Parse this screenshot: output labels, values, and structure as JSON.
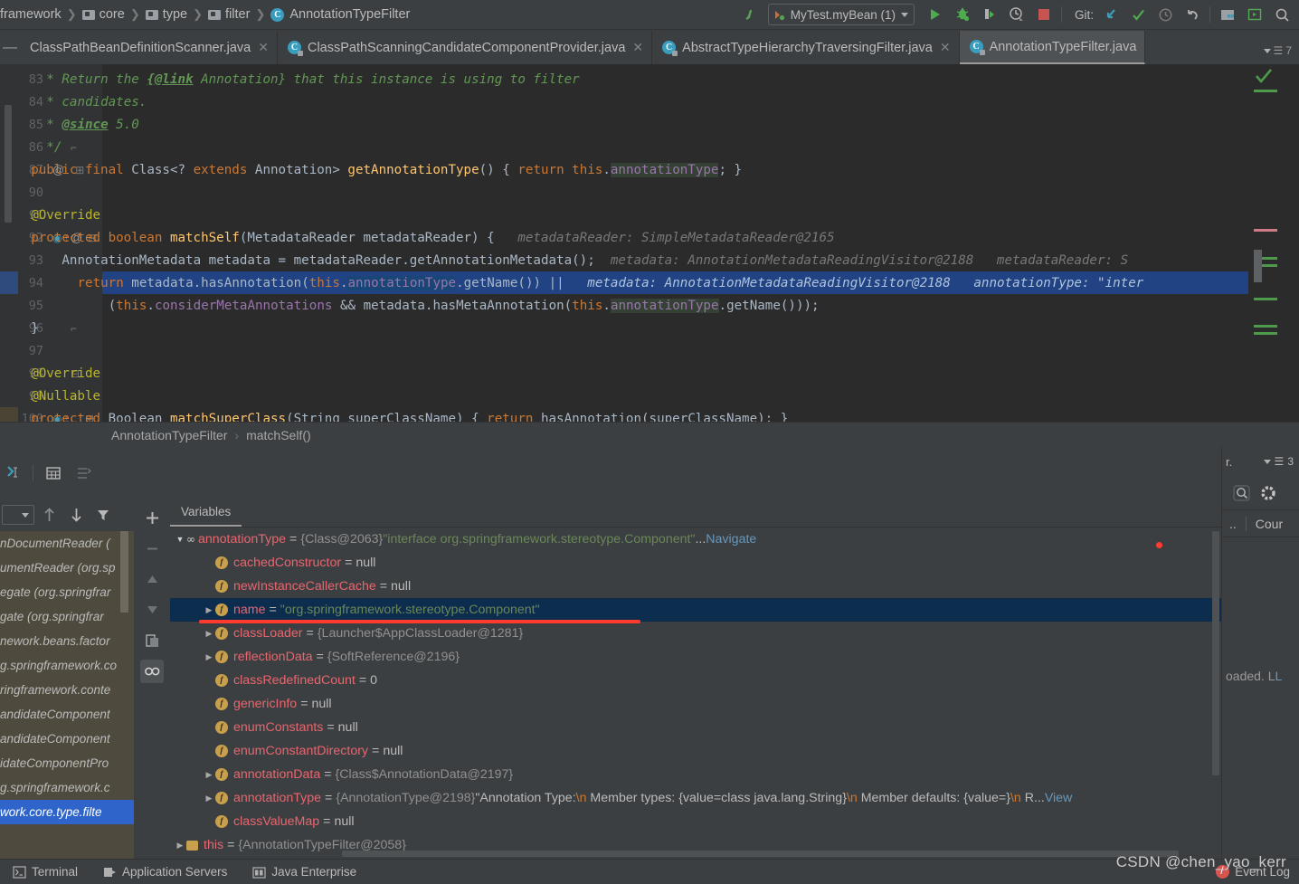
{
  "navbar": {
    "breadcrumb": [
      {
        "label": "framework",
        "icon": "none"
      },
      {
        "label": "core",
        "icon": "folder-icon"
      },
      {
        "label": "type",
        "icon": "folder-icon"
      },
      {
        "label": "filter",
        "icon": "folder-icon"
      },
      {
        "label": "AnnotationTypeFilter",
        "icon": "class-icon"
      }
    ],
    "run_config": "MyTest.myBean (1)",
    "git_label": "Git:",
    "icons": [
      "back-arrow-icon",
      "run-icon",
      "debug-icon",
      "run-with-coverage-icon",
      "profiler-icon",
      "stop-icon",
      "update-project-icon",
      "commit-icon",
      "history-icon",
      "rollback-icon",
      "project-structure-icon",
      "run-anything-icon",
      "search-everywhere-icon"
    ]
  },
  "tabs": [
    {
      "label": "ClassPathBeanDefinitionScanner.java",
      "active": false,
      "closable": true,
      "icon": false
    },
    {
      "label": "ClassPathScanningCandidateComponentProvider.java",
      "active": false,
      "closable": true,
      "icon": true
    },
    {
      "label": "AbstractTypeHierarchyTraversingFilter.java",
      "active": false,
      "closable": true,
      "icon": true
    },
    {
      "label": "AnnotationTypeFilter.java",
      "active": true,
      "closable": false,
      "icon": true
    }
  ],
  "tab_overflow_count": "7",
  "editor": {
    "lines": [
      {
        "num": "83",
        "gutter": "",
        "indent": 6,
        "segments": [
          {
            "t": "* Return the ",
            "c": "c-cmt"
          },
          {
            "t": "{@link",
            "c": "c-cmt-link"
          },
          {
            "t": " Annotation} that this instance is using to filter",
            "c": "c-cmt"
          }
        ]
      },
      {
        "num": "84",
        "gutter": "",
        "indent": 6,
        "segments": [
          {
            "t": "* candidates.",
            "c": "c-cmt"
          }
        ]
      },
      {
        "num": "85",
        "gutter": "",
        "indent": 6,
        "segments": [
          {
            "t": "* ",
            "c": "c-cmt"
          },
          {
            "t": "@since",
            "c": "c-cmt-link"
          },
          {
            "t": " 5.0",
            "c": "c-cmt"
          }
        ]
      },
      {
        "num": "86",
        "gutter": "fold-end",
        "indent": 6,
        "segments": [
          {
            "t": "*/",
            "c": "c-cmt"
          }
        ]
      },
      {
        "num": "87",
        "gutter": "at-plus",
        "indent": 4,
        "segments": [
          {
            "t": "public final ",
            "c": "c-kw"
          },
          {
            "t": "Class<? ",
            "c": "c-def"
          },
          {
            "t": "extends ",
            "c": "c-kw"
          },
          {
            "t": "Annotation> ",
            "c": "c-def"
          },
          {
            "t": "getAnnotationType",
            "c": "c-fn"
          },
          {
            "t": "() { ",
            "c": "c-def"
          },
          {
            "t": "return ",
            "c": "c-kw"
          },
          {
            "t": "this",
            "c": "c-kw"
          },
          {
            "t": ".",
            "c": "c-def"
          },
          {
            "t": "annotationType",
            "c": "c-fld c-fldbg"
          },
          {
            "t": "; }",
            "c": "c-def"
          }
        ]
      },
      {
        "num": "90",
        "gutter": "",
        "indent": 0,
        "segments": []
      },
      {
        "num": "91",
        "gutter": "",
        "indent": 4,
        "segments": [
          {
            "t": "@Override",
            "c": "c-ann"
          }
        ]
      },
      {
        "num": "92",
        "gutter": "bp-at-fold",
        "indent": 4,
        "segments": [
          {
            "t": "protected boolean ",
            "c": "c-kw"
          },
          {
            "t": "matchSelf",
            "c": "c-fn"
          },
          {
            "t": "(MetadataReader metadataReader) { ",
            "c": "c-def"
          },
          {
            "t": "  metadataReader: SimpleMetadataReader@2165",
            "c": "c-hint"
          }
        ]
      },
      {
        "num": "93",
        "gutter": "",
        "indent": 8,
        "segments": [
          {
            "t": "AnnotationMetadata metadata = metadataReader.getAnnotationMetadata();",
            "c": "c-def"
          },
          {
            "t": "  metadata: AnnotationMetadataReadingVisitor@2188",
            "c": "c-hint"
          },
          {
            "t": "   metadataReader: S",
            "c": "c-hint"
          }
        ]
      },
      {
        "num": "94",
        "gutter": "",
        "indent": 10,
        "highlight": true,
        "segments": [
          {
            "t": "return ",
            "c": "c-kw"
          },
          {
            "t": "metadata.hasAnnotation(",
            "c": "c-def"
          },
          {
            "t": "this",
            "c": "c-kw"
          },
          {
            "t": ".",
            "c": "c-def"
          },
          {
            "t": "annotationType",
            "c": "c-fld c-sel"
          },
          {
            "t": ".getName()) ",
            "c": "c-def"
          },
          {
            "t": "||",
            "c": "c-def"
          },
          {
            "t": "   metadata: AnnotationMetadataReadingVisitor@2188",
            "c": "c-hint-b"
          },
          {
            "t": "   annotationType: \"inter",
            "c": "c-hint-b"
          }
        ]
      },
      {
        "num": "95",
        "gutter": "",
        "indent": 14,
        "segments": [
          {
            "t": "(",
            "c": "c-def"
          },
          {
            "t": "this",
            "c": "c-kw"
          },
          {
            "t": ".",
            "c": "c-def"
          },
          {
            "t": "considerMetaAnnotations",
            "c": "c-fld"
          },
          {
            "t": " && metadata.hasMetaAnnotation(",
            "c": "c-def"
          },
          {
            "t": "this",
            "c": "c-kw"
          },
          {
            "t": ".",
            "c": "c-def"
          },
          {
            "t": "annotationType",
            "c": "c-fld c-fldbg"
          },
          {
            "t": ".getName()));",
            "c": "c-def"
          }
        ]
      },
      {
        "num": "96",
        "gutter": "fold-end",
        "indent": 4,
        "segments": [
          {
            "t": "}",
            "c": "c-def"
          }
        ]
      },
      {
        "num": "97",
        "gutter": "",
        "indent": 0,
        "segments": []
      },
      {
        "num": "98",
        "gutter": "fold-start",
        "indent": 4,
        "segments": [
          {
            "t": "@Override",
            "c": "c-ann"
          }
        ]
      },
      {
        "num": "99",
        "gutter": "fold-end",
        "indent": 4,
        "segments": [
          {
            "t": "@Nullable",
            "c": "c-ann"
          }
        ]
      },
      {
        "num": "100",
        "gutter": "bp-plus",
        "indent": 4,
        "segments": [
          {
            "t": "protected ",
            "c": "c-kw"
          },
          {
            "t": "Boolean ",
            "c": "c-def"
          },
          {
            "t": "matchSuperClass",
            "c": "c-fn"
          },
          {
            "t": "(String superClassName) { ",
            "c": "c-def"
          },
          {
            "t": "return ",
            "c": "c-kw"
          },
          {
            "t": "hasAnnotation(superClassName); }",
            "c": "c-def"
          }
        ]
      }
    ],
    "crumb": [
      "AnnotationTypeFilter",
      "matchSelf()"
    ]
  },
  "debug": {
    "frames_toolbar_icons": [
      "thread-selector",
      "step-up-icon",
      "step-down-icon",
      "filter-icon"
    ],
    "frames": [
      {
        "label": "work.core.type.filte",
        "selected": true
      },
      {
        "label": "g.springframework.c",
        "selected": false
      },
      {
        "label": "idateComponentPro",
        "selected": false
      },
      {
        "label": "andidateComponent",
        "selected": false
      },
      {
        "label": "andidateComponent",
        "selected": false
      },
      {
        "label": "ringframework.conte",
        "selected": false
      },
      {
        "label": "g.springframework.co",
        "selected": false
      },
      {
        "label": "nework.beans.factor",
        "selected": false
      },
      {
        "label": "gate (org.springfrar",
        "selected": false
      },
      {
        "label": "egate (org.springfrar",
        "selected": false
      },
      {
        "label": "umentReader (org.sp",
        "selected": false
      },
      {
        "label": "nDocumentReader (",
        "selected": false
      }
    ],
    "vars_tab": "Variables",
    "variables": [
      {
        "depth": 0,
        "arrow": "down",
        "icon": "oo",
        "name": "annotationType",
        "eq": "=",
        "ref": "{Class@2063}",
        "value": "\"interface org.springframework.stereotype.Component\"",
        "value_class": "vstr",
        "suffix": "...",
        "link": "Navigate",
        "selected": false
      },
      {
        "depth": 1,
        "arrow": "none",
        "icon": "f",
        "name": "cachedConstructor",
        "eq": "=",
        "ref": "",
        "value": "null",
        "value_class": "vnull",
        "selected": false
      },
      {
        "depth": 1,
        "arrow": "none",
        "icon": "f",
        "name": "newInstanceCallerCache",
        "eq": "=",
        "ref": "",
        "value": "null",
        "value_class": "vnull",
        "selected": false
      },
      {
        "depth": 1,
        "arrow": "right",
        "icon": "f",
        "name": "name",
        "eq": "=",
        "ref": "",
        "value": "\"org.springframework.stereotype.Component\"",
        "value_class": "vstr",
        "selected": true,
        "underlined": true
      },
      {
        "depth": 1,
        "arrow": "right",
        "icon": "f",
        "name": "classLoader",
        "eq": "=",
        "ref": "{Launcher$AppClassLoader@1281}",
        "value": "",
        "selected": false
      },
      {
        "depth": 1,
        "arrow": "right",
        "icon": "f",
        "name": "reflectionData",
        "eq": "=",
        "ref": "{SoftReference@2196}",
        "value": "",
        "selected": false
      },
      {
        "depth": 1,
        "arrow": "none",
        "icon": "f",
        "name": "classRedefinedCount",
        "eq": "=",
        "ref": "",
        "value": "0",
        "value_class": "vnum",
        "selected": false
      },
      {
        "depth": 1,
        "arrow": "none",
        "icon": "f",
        "name": "genericInfo",
        "eq": "=",
        "ref": "",
        "value": "null",
        "value_class": "vnull",
        "selected": false
      },
      {
        "depth": 1,
        "arrow": "none",
        "icon": "f",
        "name": "enumConstants",
        "eq": "=",
        "ref": "",
        "value": "null",
        "value_class": "vnull",
        "selected": false
      },
      {
        "depth": 1,
        "arrow": "none",
        "icon": "f",
        "name": "enumConstantDirectory",
        "eq": "=",
        "ref": "",
        "value": "null",
        "value_class": "vnull",
        "selected": false
      },
      {
        "depth": 1,
        "arrow": "right",
        "icon": "f",
        "name": "annotationData",
        "eq": "=",
        "ref": "{Class$AnnotationData@2197}",
        "value": "",
        "selected": false
      },
      {
        "depth": 1,
        "arrow": "right",
        "icon": "f",
        "name": "annotationType",
        "eq": "=",
        "ref": "{AnnotationType@2198}",
        "value": "\"Annotation Type:\\n  Member types: {value=class java.lang.String}\\n  Member defaults: {value=}\\n  R...",
        "value_class": "vnull",
        "link": "View",
        "selected": false
      },
      {
        "depth": 1,
        "arrow": "none",
        "icon": "f",
        "name": "classValueMap",
        "eq": "=",
        "ref": "",
        "value": "null",
        "value_class": "vnull",
        "selected": false
      },
      {
        "depth": 0,
        "arrow": "right",
        "icon": "this",
        "name": "this",
        "eq": "=",
        "ref": "{AnnotationTypeFilter@2058}",
        "value": "",
        "selected": false
      }
    ],
    "right_panel": {
      "tab_count": "3",
      "tab_label": "r.",
      "icons": [
        "search-icon",
        "gear-icon"
      ],
      "header": [
        "..",
        "Cour"
      ],
      "text": "oaded. L"
    },
    "left_tools": [
      "restore-layout-icon",
      "table-view-icon",
      "grouping-icon"
    ],
    "corner_icons": [
      "settings-gear-icon",
      "minimize-icon",
      "layout-icon"
    ]
  },
  "statusbar": {
    "items": [
      {
        "label": "Terminal",
        "icon": "terminal-icon"
      },
      {
        "label": "Application Servers",
        "icon": "server-icon"
      },
      {
        "label": "Java Enterprise",
        "icon": "java-ee-icon"
      }
    ],
    "event_log": "Event Log",
    "watermark": "CSDN @chen_yao_kerr"
  }
}
